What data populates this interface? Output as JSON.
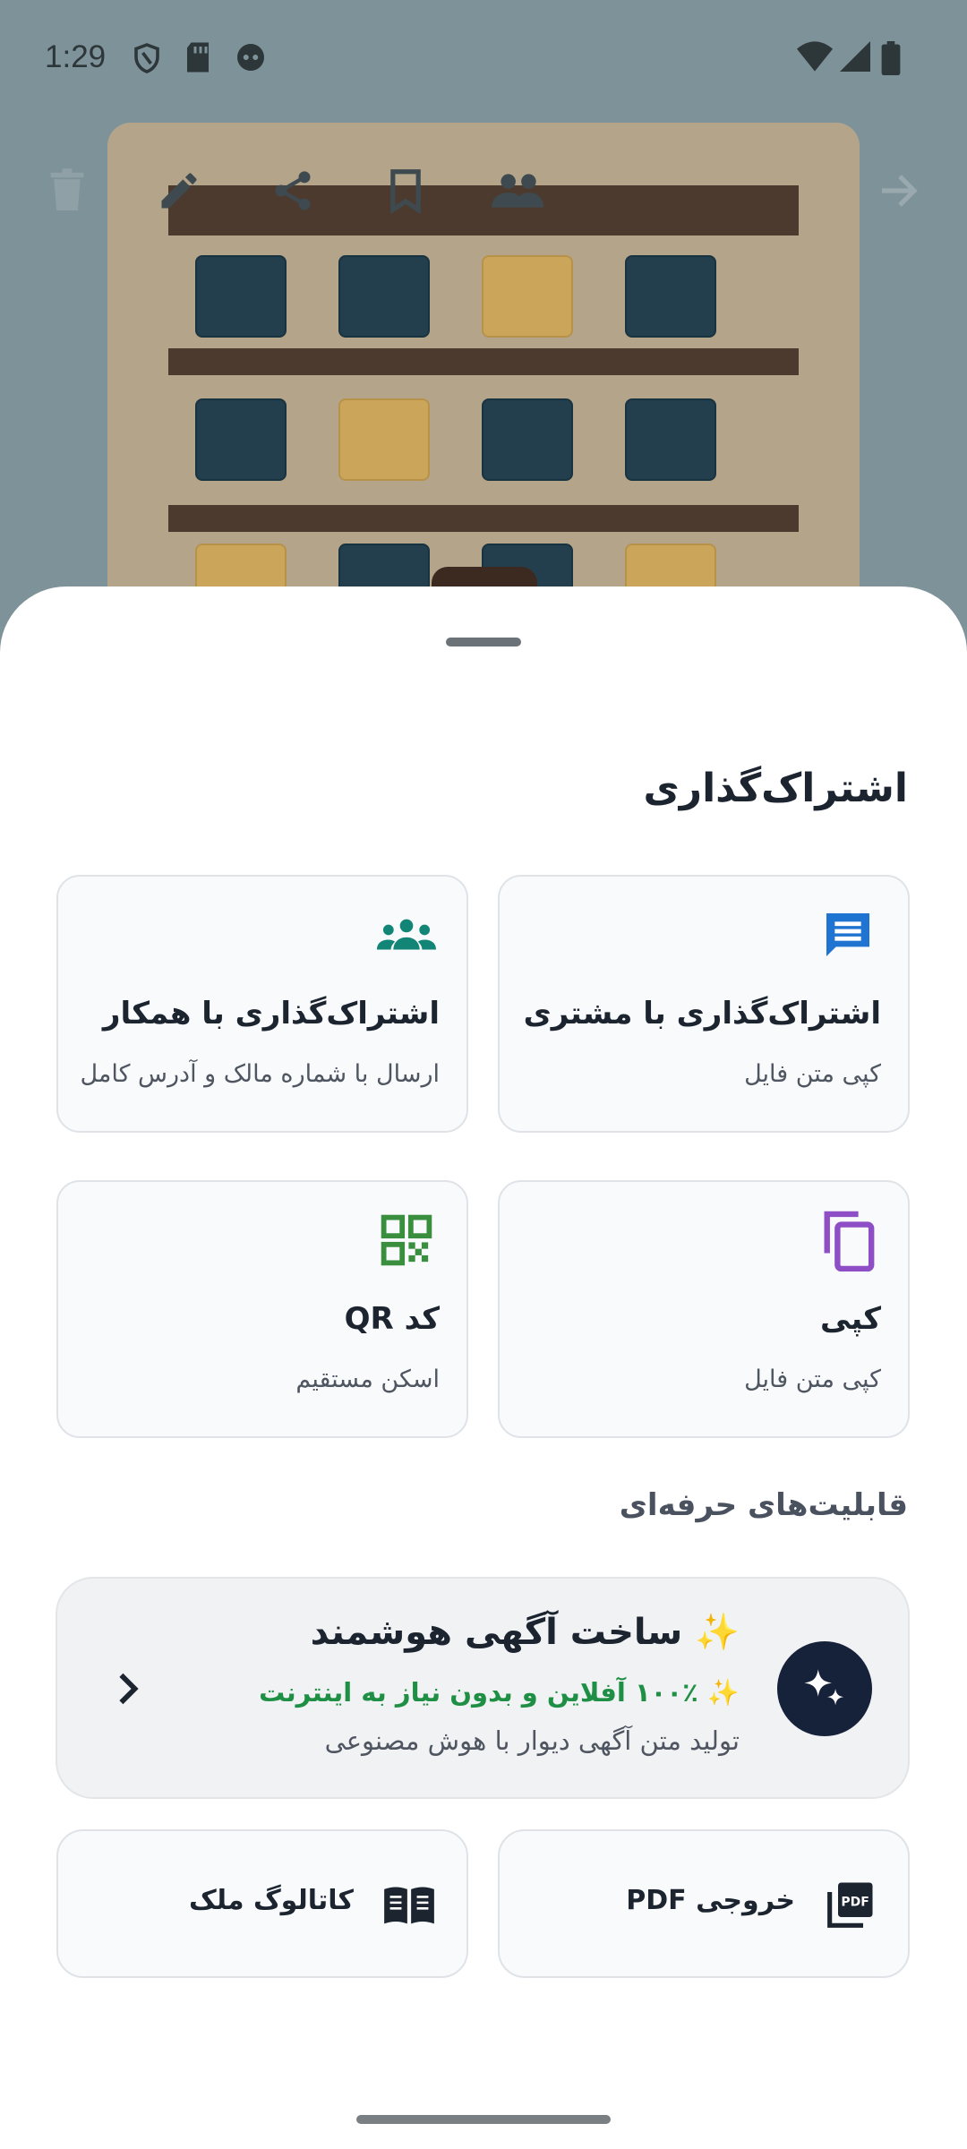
{
  "status_bar": {
    "time": "1:29",
    "icons": [
      "shield-icon",
      "sd-card-icon",
      "face-icon",
      "wifi-icon",
      "signal-icon",
      "battery-icon"
    ]
  },
  "toolbar_icons": [
    "delete-icon",
    "edit-icon",
    "share-icon",
    "bookmark-icon",
    "group-icon",
    "forward-arrow-icon"
  ],
  "sheet": {
    "title": "اشتراک‌گذاری",
    "share_options": [
      {
        "title": "اشتراک‌گذاری با مشتری",
        "subtitle": "کپی متن فایل",
        "icon": "chat-icon",
        "color": "#1f73d1"
      },
      {
        "title": "اشتراک‌گذاری با همکار",
        "subtitle": "ارسال با شماره مالک و آدرس کامل",
        "icon": "group-icon",
        "color": "#128576"
      },
      {
        "title": "کپی",
        "subtitle": "کپی متن فایل",
        "icon": "copy-icon",
        "color": "#8e4fc6"
      },
      {
        "title": "کد QR",
        "subtitle": "اسکن مستقیم",
        "icon": "qr-code-icon",
        "color": "#3a8f3e"
      }
    ],
    "pro_section_title": "قابلیت‌های حرفه‌ای",
    "ai_ad": {
      "title": "✨ ساخت آگهی هوشمند",
      "highlight": "✨ ۱۰۰٪ آفلاین و بدون نیاز به اینترنت",
      "subtitle": "تولید متن آگهی دیوار با هوش مصنوعی",
      "icon": "sparkles-icon"
    },
    "mini_actions": [
      {
        "label": "خروجی PDF",
        "icon": "pdf-icon"
      },
      {
        "label": "کاتالوگ ملک",
        "icon": "book-icon"
      }
    ]
  },
  "colors": {
    "sheet_bg": "#ffffff",
    "card_bg": "#f8fafc",
    "ai_badge": "#16213a",
    "green_text": "#1f8f45"
  }
}
